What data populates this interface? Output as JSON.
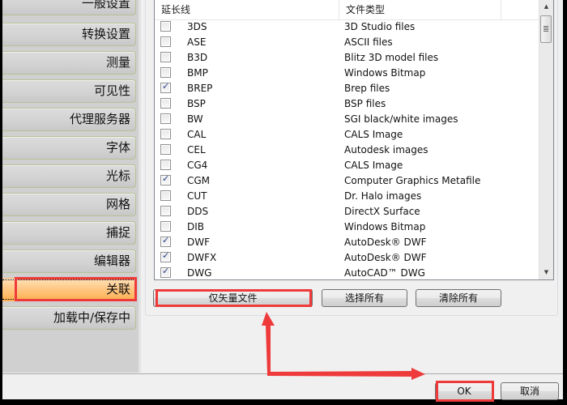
{
  "sidebar": {
    "items": [
      {
        "label": "一般设置",
        "active": false
      },
      {
        "label": "转换设置",
        "active": false
      },
      {
        "label": "测量",
        "active": false
      },
      {
        "label": "可见性",
        "active": false
      },
      {
        "label": "代理服务器",
        "active": false
      },
      {
        "label": "字体",
        "active": false
      },
      {
        "label": "光标",
        "active": false
      },
      {
        "label": "网格",
        "active": false
      },
      {
        "label": "捕捉",
        "active": false
      },
      {
        "label": "编辑器",
        "active": false
      },
      {
        "label": "关联",
        "active": true
      },
      {
        "label": "加载中/保存中",
        "active": false
      }
    ]
  },
  "file_list": {
    "columns": [
      "延长线",
      "文件类型"
    ],
    "rows": [
      {
        "ext": "3DS",
        "type": "3D Studio files",
        "checked": false
      },
      {
        "ext": "ASE",
        "type": "ASCII files",
        "checked": false
      },
      {
        "ext": "B3D",
        "type": "Blitz 3D model files",
        "checked": false
      },
      {
        "ext": "BMP",
        "type": "Windows Bitmap",
        "checked": false
      },
      {
        "ext": "BREP",
        "type": "Brep files",
        "checked": true
      },
      {
        "ext": "BSP",
        "type": "BSP files",
        "checked": false
      },
      {
        "ext": "BW",
        "type": "SGI black/white images",
        "checked": false
      },
      {
        "ext": "CAL",
        "type": "CALS Image",
        "checked": false
      },
      {
        "ext": "CEL",
        "type": "Autodesk images",
        "checked": false
      },
      {
        "ext": "CG4",
        "type": "CALS Image",
        "checked": false
      },
      {
        "ext": "CGM",
        "type": "Computer Graphics Metafile",
        "checked": true
      },
      {
        "ext": "CUT",
        "type": "Dr. Halo images",
        "checked": false
      },
      {
        "ext": "DDS",
        "type": "DirectX Surface",
        "checked": false
      },
      {
        "ext": "DIB",
        "type": "Windows Bitmap",
        "checked": false
      },
      {
        "ext": "DWF",
        "type": "AutoDesk® DWF",
        "checked": true
      },
      {
        "ext": "DWFX",
        "type": "AutoDesk® DWF",
        "checked": true
      },
      {
        "ext": "DWG",
        "type": "AutoCAD™ DWG",
        "checked": true
      }
    ]
  },
  "buttons": {
    "vector_only": "仅矢量文件",
    "select_all": "选择所有",
    "clear_all": "清除所有",
    "ok": "OK",
    "cancel": "取消"
  },
  "annotation_color": "#ee3a3a"
}
